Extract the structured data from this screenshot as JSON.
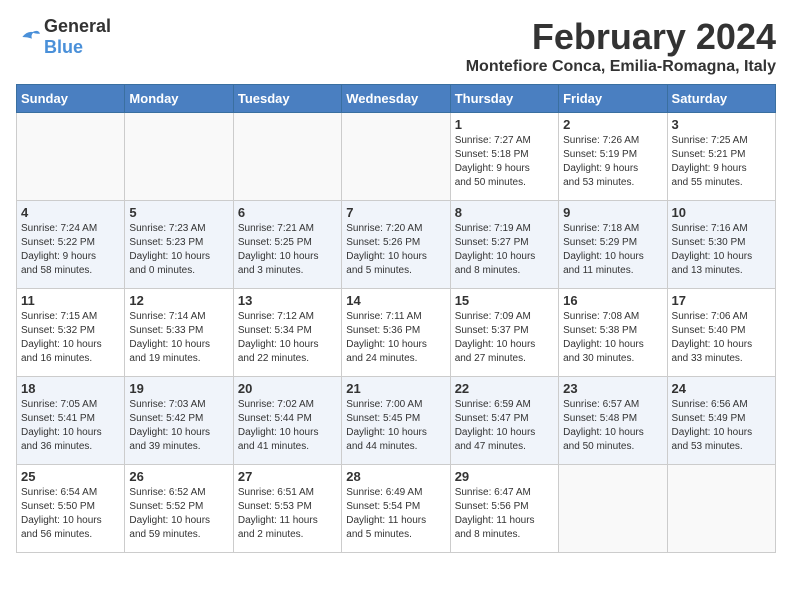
{
  "header": {
    "logo_general": "General",
    "logo_blue": "Blue",
    "month_title": "February 2024",
    "location": "Montefiore Conca, Emilia-Romagna, Italy"
  },
  "days_of_week": [
    "Sunday",
    "Monday",
    "Tuesday",
    "Wednesday",
    "Thursday",
    "Friday",
    "Saturday"
  ],
  "weeks": [
    [
      {
        "date": "",
        "info": ""
      },
      {
        "date": "",
        "info": ""
      },
      {
        "date": "",
        "info": ""
      },
      {
        "date": "",
        "info": ""
      },
      {
        "date": "1",
        "info": "Sunrise: 7:27 AM\nSunset: 5:18 PM\nDaylight: 9 hours\nand 50 minutes."
      },
      {
        "date": "2",
        "info": "Sunrise: 7:26 AM\nSunset: 5:19 PM\nDaylight: 9 hours\nand 53 minutes."
      },
      {
        "date": "3",
        "info": "Sunrise: 7:25 AM\nSunset: 5:21 PM\nDaylight: 9 hours\nand 55 minutes."
      }
    ],
    [
      {
        "date": "4",
        "info": "Sunrise: 7:24 AM\nSunset: 5:22 PM\nDaylight: 9 hours\nand 58 minutes."
      },
      {
        "date": "5",
        "info": "Sunrise: 7:23 AM\nSunset: 5:23 PM\nDaylight: 10 hours\nand 0 minutes."
      },
      {
        "date": "6",
        "info": "Sunrise: 7:21 AM\nSunset: 5:25 PM\nDaylight: 10 hours\nand 3 minutes."
      },
      {
        "date": "7",
        "info": "Sunrise: 7:20 AM\nSunset: 5:26 PM\nDaylight: 10 hours\nand 5 minutes."
      },
      {
        "date": "8",
        "info": "Sunrise: 7:19 AM\nSunset: 5:27 PM\nDaylight: 10 hours\nand 8 minutes."
      },
      {
        "date": "9",
        "info": "Sunrise: 7:18 AM\nSunset: 5:29 PM\nDaylight: 10 hours\nand 11 minutes."
      },
      {
        "date": "10",
        "info": "Sunrise: 7:16 AM\nSunset: 5:30 PM\nDaylight: 10 hours\nand 13 minutes."
      }
    ],
    [
      {
        "date": "11",
        "info": "Sunrise: 7:15 AM\nSunset: 5:32 PM\nDaylight: 10 hours\nand 16 minutes."
      },
      {
        "date": "12",
        "info": "Sunrise: 7:14 AM\nSunset: 5:33 PM\nDaylight: 10 hours\nand 19 minutes."
      },
      {
        "date": "13",
        "info": "Sunrise: 7:12 AM\nSunset: 5:34 PM\nDaylight: 10 hours\nand 22 minutes."
      },
      {
        "date": "14",
        "info": "Sunrise: 7:11 AM\nSunset: 5:36 PM\nDaylight: 10 hours\nand 24 minutes."
      },
      {
        "date": "15",
        "info": "Sunrise: 7:09 AM\nSunset: 5:37 PM\nDaylight: 10 hours\nand 27 minutes."
      },
      {
        "date": "16",
        "info": "Sunrise: 7:08 AM\nSunset: 5:38 PM\nDaylight: 10 hours\nand 30 minutes."
      },
      {
        "date": "17",
        "info": "Sunrise: 7:06 AM\nSunset: 5:40 PM\nDaylight: 10 hours\nand 33 minutes."
      }
    ],
    [
      {
        "date": "18",
        "info": "Sunrise: 7:05 AM\nSunset: 5:41 PM\nDaylight: 10 hours\nand 36 minutes."
      },
      {
        "date": "19",
        "info": "Sunrise: 7:03 AM\nSunset: 5:42 PM\nDaylight: 10 hours\nand 39 minutes."
      },
      {
        "date": "20",
        "info": "Sunrise: 7:02 AM\nSunset: 5:44 PM\nDaylight: 10 hours\nand 41 minutes."
      },
      {
        "date": "21",
        "info": "Sunrise: 7:00 AM\nSunset: 5:45 PM\nDaylight: 10 hours\nand 44 minutes."
      },
      {
        "date": "22",
        "info": "Sunrise: 6:59 AM\nSunset: 5:47 PM\nDaylight: 10 hours\nand 47 minutes."
      },
      {
        "date": "23",
        "info": "Sunrise: 6:57 AM\nSunset: 5:48 PM\nDaylight: 10 hours\nand 50 minutes."
      },
      {
        "date": "24",
        "info": "Sunrise: 6:56 AM\nSunset: 5:49 PM\nDaylight: 10 hours\nand 53 minutes."
      }
    ],
    [
      {
        "date": "25",
        "info": "Sunrise: 6:54 AM\nSunset: 5:50 PM\nDaylight: 10 hours\nand 56 minutes."
      },
      {
        "date": "26",
        "info": "Sunrise: 6:52 AM\nSunset: 5:52 PM\nDaylight: 10 hours\nand 59 minutes."
      },
      {
        "date": "27",
        "info": "Sunrise: 6:51 AM\nSunset: 5:53 PM\nDaylight: 11 hours\nand 2 minutes."
      },
      {
        "date": "28",
        "info": "Sunrise: 6:49 AM\nSunset: 5:54 PM\nDaylight: 11 hours\nand 5 minutes."
      },
      {
        "date": "29",
        "info": "Sunrise: 6:47 AM\nSunset: 5:56 PM\nDaylight: 11 hours\nand 8 minutes."
      },
      {
        "date": "",
        "info": ""
      },
      {
        "date": "",
        "info": ""
      }
    ]
  ]
}
